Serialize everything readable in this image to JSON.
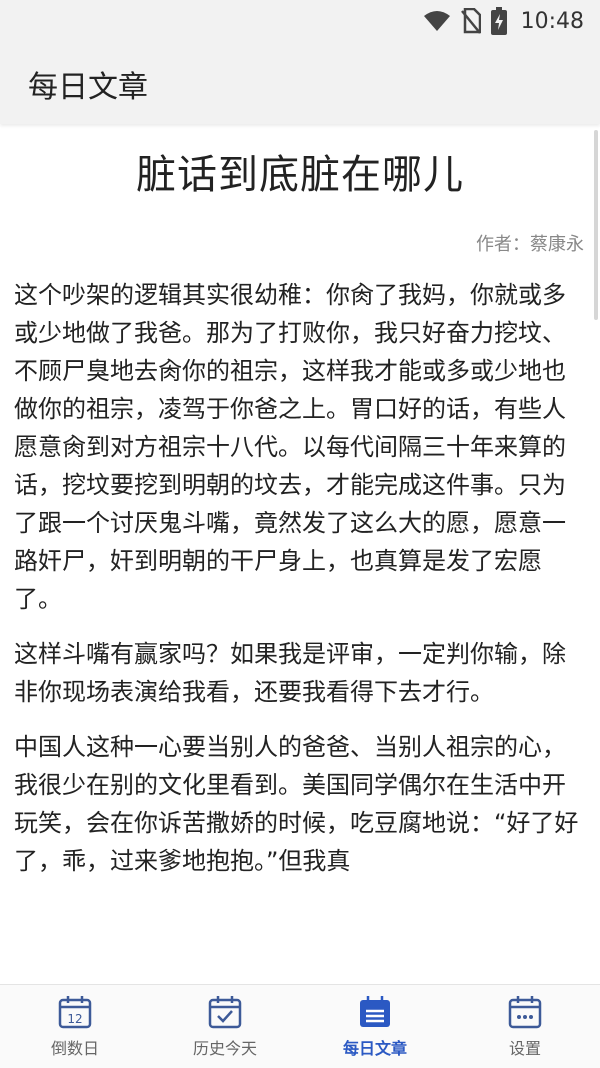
{
  "status_bar": {
    "time": "10:48",
    "icons": [
      "wifi-icon",
      "no-sim-icon",
      "battery-charging-icon"
    ]
  },
  "app_bar": {
    "title": "每日文章"
  },
  "article": {
    "title": "脏话到底脏在哪儿",
    "author": "作者：蔡康永",
    "paragraphs": [
      "这个吵架的逻辑其实很幼稚：你肏了我妈，你就或多或少地做了我爸。那为了打败你，我只好奋力挖坟、不顾尸臭地去肏你的祖宗，这样我才能或多或少地也做你的祖宗，凌驾于你爸之上。胃口好的话，有些人愿意肏到对方祖宗十八代。以每代间隔三十年来算的话，挖坟要挖到明朝的坟去，才能完成这件事。只为了跟一个讨厌鬼斗嘴，竟然发了这么大的愿，愿意一路奸尸，奸到明朝的干尸身上，也真算是发了宏愿了。",
      "这样斗嘴有赢家吗？如果我是评审，一定判你输，除非你现场表演给我看，还要我看得下去才行。",
      "中国人这种一心要当别人的爸爸、当别人祖宗的心，我很少在别的文化里看到。美国同学偶尔在生活中开玩笑，会在你诉苦撒娇的时候，吃豆腐地说：“好了好了，乖，过来爹地抱抱。”但我真"
    ]
  },
  "bottom_nav": {
    "items": [
      {
        "label": "倒数日",
        "icon": "calendar-12-icon",
        "active": false
      },
      {
        "label": "历史今天",
        "icon": "calendar-check-icon",
        "active": false
      },
      {
        "label": "每日文章",
        "icon": "calendar-article-icon",
        "active": true
      },
      {
        "label": "设置",
        "icon": "calendar-dots-icon",
        "active": false
      }
    ],
    "day_number": "12"
  },
  "colors": {
    "active": "#2b59c3",
    "inactive": "#666666",
    "bar_background": "#f2f2f2"
  }
}
